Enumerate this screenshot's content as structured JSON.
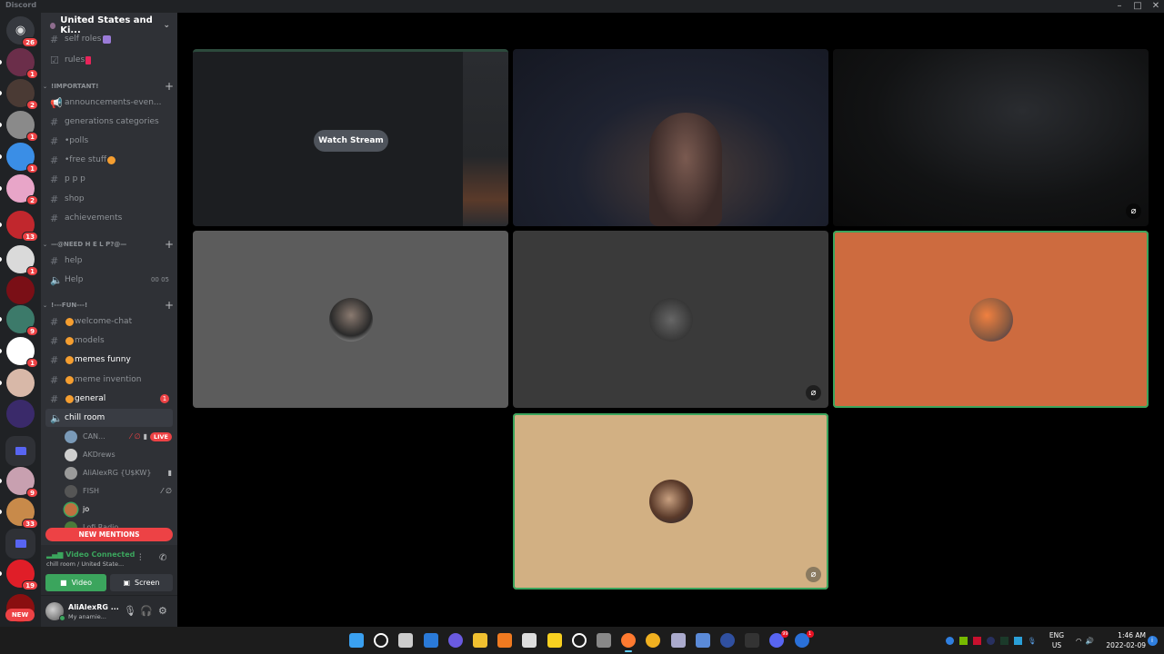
{
  "window": {
    "app_title": "Discord",
    "controls": [
      "minimize",
      "maximize",
      "close"
    ]
  },
  "guilds": {
    "home_badge": "26",
    "items": [
      {
        "name": "server-1",
        "badge": "1",
        "color": "#6b2e4a"
      },
      {
        "name": "server-2",
        "badge": "2",
        "color": "#4a3a34"
      },
      {
        "name": "server-3",
        "badge": "1",
        "color": "#8a8a8a"
      },
      {
        "name": "server-4",
        "badge": "1",
        "color": "#3a8ee6"
      },
      {
        "name": "server-5",
        "badge": "2",
        "color": "#e8a5c8"
      },
      {
        "name": "server-6",
        "badge": "13",
        "color": "#c1272d"
      },
      {
        "name": "server-7",
        "badge": "1",
        "color": "#dadada"
      },
      {
        "name": "server-8",
        "badge": "",
        "color": "#7a0f16"
      },
      {
        "name": "server-9",
        "badge": "9",
        "color": "#3c7a6a"
      },
      {
        "name": "server-10",
        "badge": "1",
        "color": "#ffffff"
      },
      {
        "name": "server-11",
        "badge": "",
        "color": "#d8b8a8"
      },
      {
        "name": "server-12",
        "badge": "",
        "color": "#3a2a6a"
      },
      {
        "name": "server-gc",
        "badge": "9",
        "color": "#c8a0b0"
      },
      {
        "name": "server-14",
        "badge": "33",
        "color": "#c88a4a"
      },
      {
        "name": "server-15",
        "badge": "19",
        "color": "#e01e28"
      }
    ],
    "new_label": "NEW"
  },
  "server": {
    "name": "United States and Ki...",
    "channels_top": [
      {
        "label": "self roles",
        "type": "text"
      },
      {
        "label": "rules",
        "type": "rules"
      }
    ],
    "categories": [
      {
        "label": "!IMPORTANT!",
        "channels": [
          {
            "label": "announcements-even...",
            "type": "announcement"
          },
          {
            "label": "generations categories",
            "type": "text"
          },
          {
            "label": "•polls",
            "type": "text"
          },
          {
            "label": "•free stuff",
            "type": "text"
          },
          {
            "label": "p p p",
            "type": "text"
          },
          {
            "label": "shop",
            "type": "text"
          },
          {
            "label": "achievements",
            "type": "text"
          }
        ]
      },
      {
        "label": "—@NEED H E L P?@—",
        "channels": [
          {
            "label": "help",
            "type": "text"
          },
          {
            "label": "Help",
            "type": "voice",
            "timer": "00 05"
          }
        ]
      },
      {
        "label": "!---FUN---!",
        "channels": [
          {
            "label": "welcome-chat",
            "type": "text"
          },
          {
            "label": "models",
            "type": "text"
          },
          {
            "label": "memes funny",
            "type": "text",
            "unread": true
          },
          {
            "label": "meme invention",
            "type": "text"
          },
          {
            "label": "general",
            "type": "text",
            "unread": true,
            "mentions": "1"
          },
          {
            "label": "chill room",
            "type": "voice",
            "active": true
          }
        ]
      }
    ],
    "voice_users": [
      {
        "name": "CAN...",
        "live": "LIVE",
        "color": "#7a9ab8"
      },
      {
        "name": "AKDrews",
        "color": "#cfcfcf"
      },
      {
        "name": "AliAlexRG {U$KW}",
        "color": "#9a9a9a"
      },
      {
        "name": "FISH",
        "color": "#555555"
      },
      {
        "name": "jo",
        "color": "#c07040"
      },
      {
        "name": "Lofi Radio",
        "color": "#4a7a3a"
      }
    ],
    "new_mentions": "NEW MENTIONS"
  },
  "rtc": {
    "status": "Video Connected",
    "location": "chill room / United State...",
    "video_label": "Video",
    "screen_label": "Screen"
  },
  "user": {
    "name": "AliAlexRG ...",
    "status": "My anamie..."
  },
  "stage": {
    "watch_stream": "Watch Stream",
    "tiles": [
      {
        "name": "stream-tile",
        "kind": "stream"
      },
      {
        "name": "camera-tile-1",
        "kind": "camera"
      },
      {
        "name": "camera-tile-2",
        "kind": "camera",
        "deafened": true
      },
      {
        "name": "avatar-tile-akdrews",
        "kind": "avatar",
        "bg": "#5c5c5c"
      },
      {
        "name": "avatar-tile-fish",
        "kind": "avatar",
        "bg": "#3a3a3a",
        "deafened": true
      },
      {
        "name": "avatar-tile-jo",
        "kind": "avatar",
        "bg": "#cd6b3f",
        "speaking": true
      },
      {
        "name": "avatar-tile-lofi",
        "kind": "avatar",
        "bg": "#d2b083",
        "speaking": true,
        "deafened": true
      }
    ]
  },
  "taskbar": {
    "apps": [
      "start",
      "search",
      "task-view",
      "widgets",
      "teams-chat",
      "file-explorer",
      "search-tool",
      "drive",
      "sticky-notes",
      "logitech-g-hub",
      "app-unknown",
      "firefox",
      "emoji-app",
      "settings",
      "network-app",
      "ball-app",
      "terminal",
      "discord",
      "edge-app"
    ],
    "discord_badge": "99",
    "edge_badge": "1",
    "language": "ENG",
    "region": "US",
    "time": "1:46 AM",
    "date": "2022-02-09"
  }
}
